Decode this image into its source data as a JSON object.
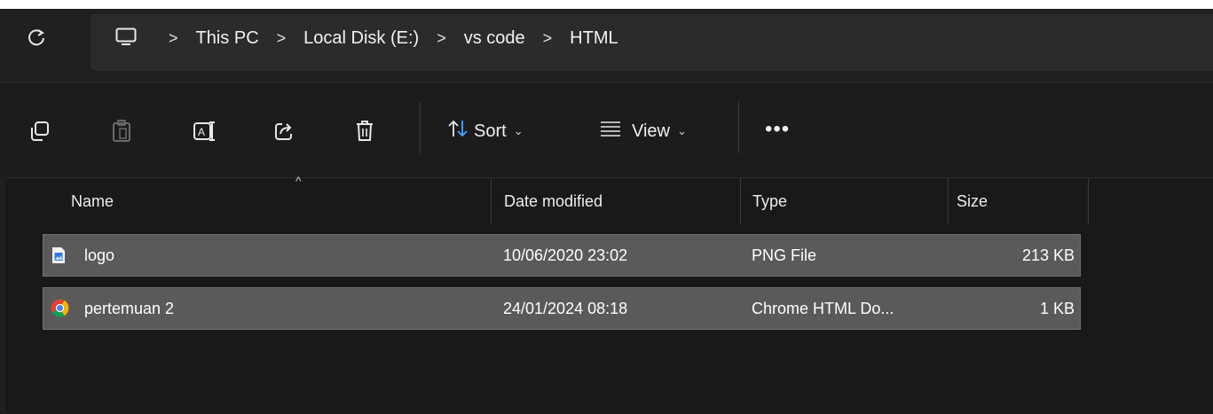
{
  "addressbar": {
    "crumbs": [
      "This PC",
      "Local Disk (E:)",
      "vs code",
      "HTML"
    ]
  },
  "toolbar": {
    "sort_label": "Sort",
    "view_label": "View",
    "more_label": "•••"
  },
  "columns": {
    "name": "Name",
    "date": "Date modified",
    "type": "Type",
    "size": "Size"
  },
  "files": [
    {
      "name": "logo",
      "date": "10/06/2020 23:02",
      "type": "PNG File",
      "size": "213 KB",
      "icon": "png-file-icon"
    },
    {
      "name": "pertemuan 2",
      "date": "24/01/2024 08:18",
      "type": "Chrome HTML Do...",
      "size": "1 KB",
      "icon": "chrome-html-icon"
    }
  ],
  "colors": {
    "background": "#1c1c1c",
    "selection": "#5a5a5a",
    "selection_border": "#707070"
  }
}
